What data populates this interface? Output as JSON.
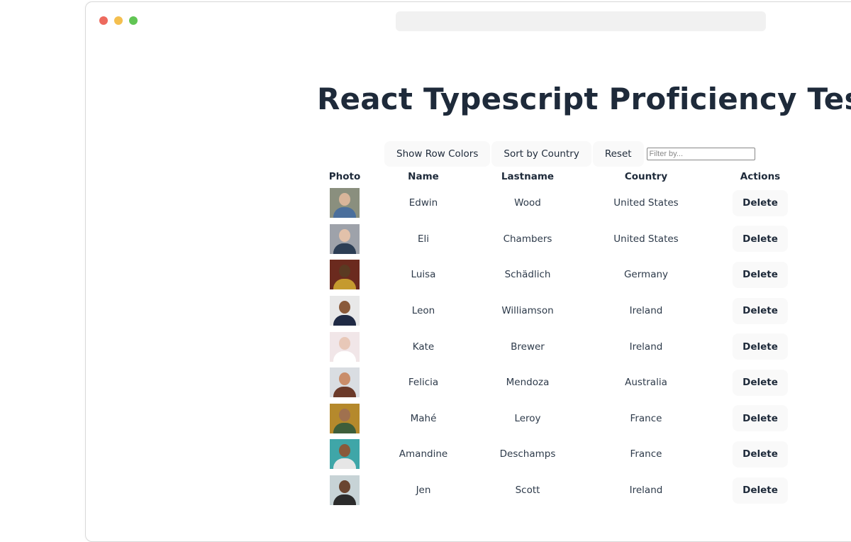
{
  "window": {
    "traffic_colors": [
      "#ed6a5e",
      "#f4bf4f",
      "#61c554"
    ]
  },
  "page": {
    "title": "React Typescript Proficiency Test"
  },
  "toolbar": {
    "show_row_colors_label": "Show Row Colors",
    "sort_by_country_label": "Sort by Country",
    "reset_label": "Reset",
    "filter_placeholder": "Filter by...",
    "filter_value": ""
  },
  "table": {
    "headers": [
      "Photo",
      "Name",
      "Lastname",
      "Country",
      "Actions"
    ],
    "delete_label": "Delete",
    "rows": [
      {
        "name": "Edwin",
        "lastname": "Wood",
        "country": "United States",
        "photo_bg": "#8a8f7e",
        "photo_head": "#d9b59a",
        "photo_body": "#4b6f9c"
      },
      {
        "name": "Eli",
        "lastname": "Chambers",
        "country": "United States",
        "photo_bg": "#9ea2aa",
        "photo_head": "#e2c1aa",
        "photo_body": "#2c3e55"
      },
      {
        "name": "Luisa",
        "lastname": "Schädlich",
        "country": "Germany",
        "photo_bg": "#6b2a1e",
        "photo_head": "#5a3a22",
        "photo_body": "#c59a2e"
      },
      {
        "name": "Leon",
        "lastname": "Williamson",
        "country": "Ireland",
        "photo_bg": "#e8e8e8",
        "photo_head": "#8a5a3a",
        "photo_body": "#1f2a44"
      },
      {
        "name": "Kate",
        "lastname": "Brewer",
        "country": "Ireland",
        "photo_bg": "#f1e6e8",
        "photo_head": "#e8c8b8",
        "photo_body": "#ffffff"
      },
      {
        "name": "Felicia",
        "lastname": "Mendoza",
        "country": "Australia",
        "photo_bg": "#d9dde2",
        "photo_head": "#c98d6a",
        "photo_body": "#6b3a2a"
      },
      {
        "name": "Mahé",
        "lastname": "Leroy",
        "country": "France",
        "photo_bg": "#b5892c",
        "photo_head": "#a0714f",
        "photo_body": "#3e5e3a"
      },
      {
        "name": "Amandine",
        "lastname": "Deschamps",
        "country": "France",
        "photo_bg": "#3fa6a8",
        "photo_head": "#8a5a3a",
        "photo_body": "#e6e6e6"
      },
      {
        "name": "Jen",
        "lastname": "Scott",
        "country": "Ireland",
        "photo_bg": "#c7d3d6",
        "photo_head": "#6a4530",
        "photo_body": "#2b2b2b"
      }
    ]
  }
}
